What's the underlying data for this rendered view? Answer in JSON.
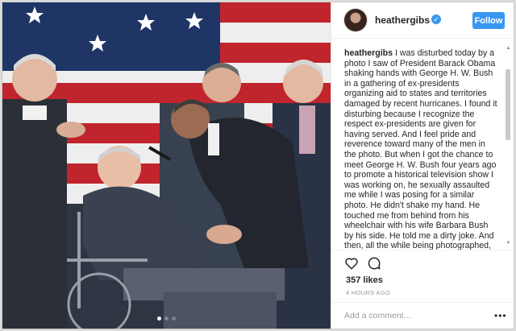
{
  "post": {
    "username": "heathergibs",
    "follow_label": "Follow",
    "caption_username": "heathergibs",
    "caption_text": "I was disturbed today by a photo I saw of President Barack Obama shaking hands with George H. W. Bush in a gathering of ex-presidents organizing aid to states and territories damaged by recent hurricanes. I found it disturbing because I recognize the respect ex-presidents are given for having served. And I feel pride and reverence toward many of the men in the photo. But when I got the chance to meet George H. W. Bush four years ago to promote a historical television show I was working on, he sexually assaulted me while I was posing for a similar photo. He didn't shake my hand. He touched me from behind from his wheelchair with his wife Barbara Bush by his side. He told me a dirty joke. And then, all the while being photographed, touched me again. Barbara rolled her eyes as if to say \"not again\". His security guard told me I shouldn't have",
    "likes": "357 likes",
    "time": "4 HOURS AGO",
    "comment_placeholder": "Add a comment...",
    "more_label": "•••",
    "photo_dot_count": 3
  },
  "icons": {
    "like": "heart-icon",
    "comment": "comment-bubble-icon",
    "verified": "verified-badge-icon",
    "more": "more-options-icon"
  },
  "colors": {
    "accent": "#3897f0",
    "text": "#262626",
    "muted": "#999999"
  }
}
